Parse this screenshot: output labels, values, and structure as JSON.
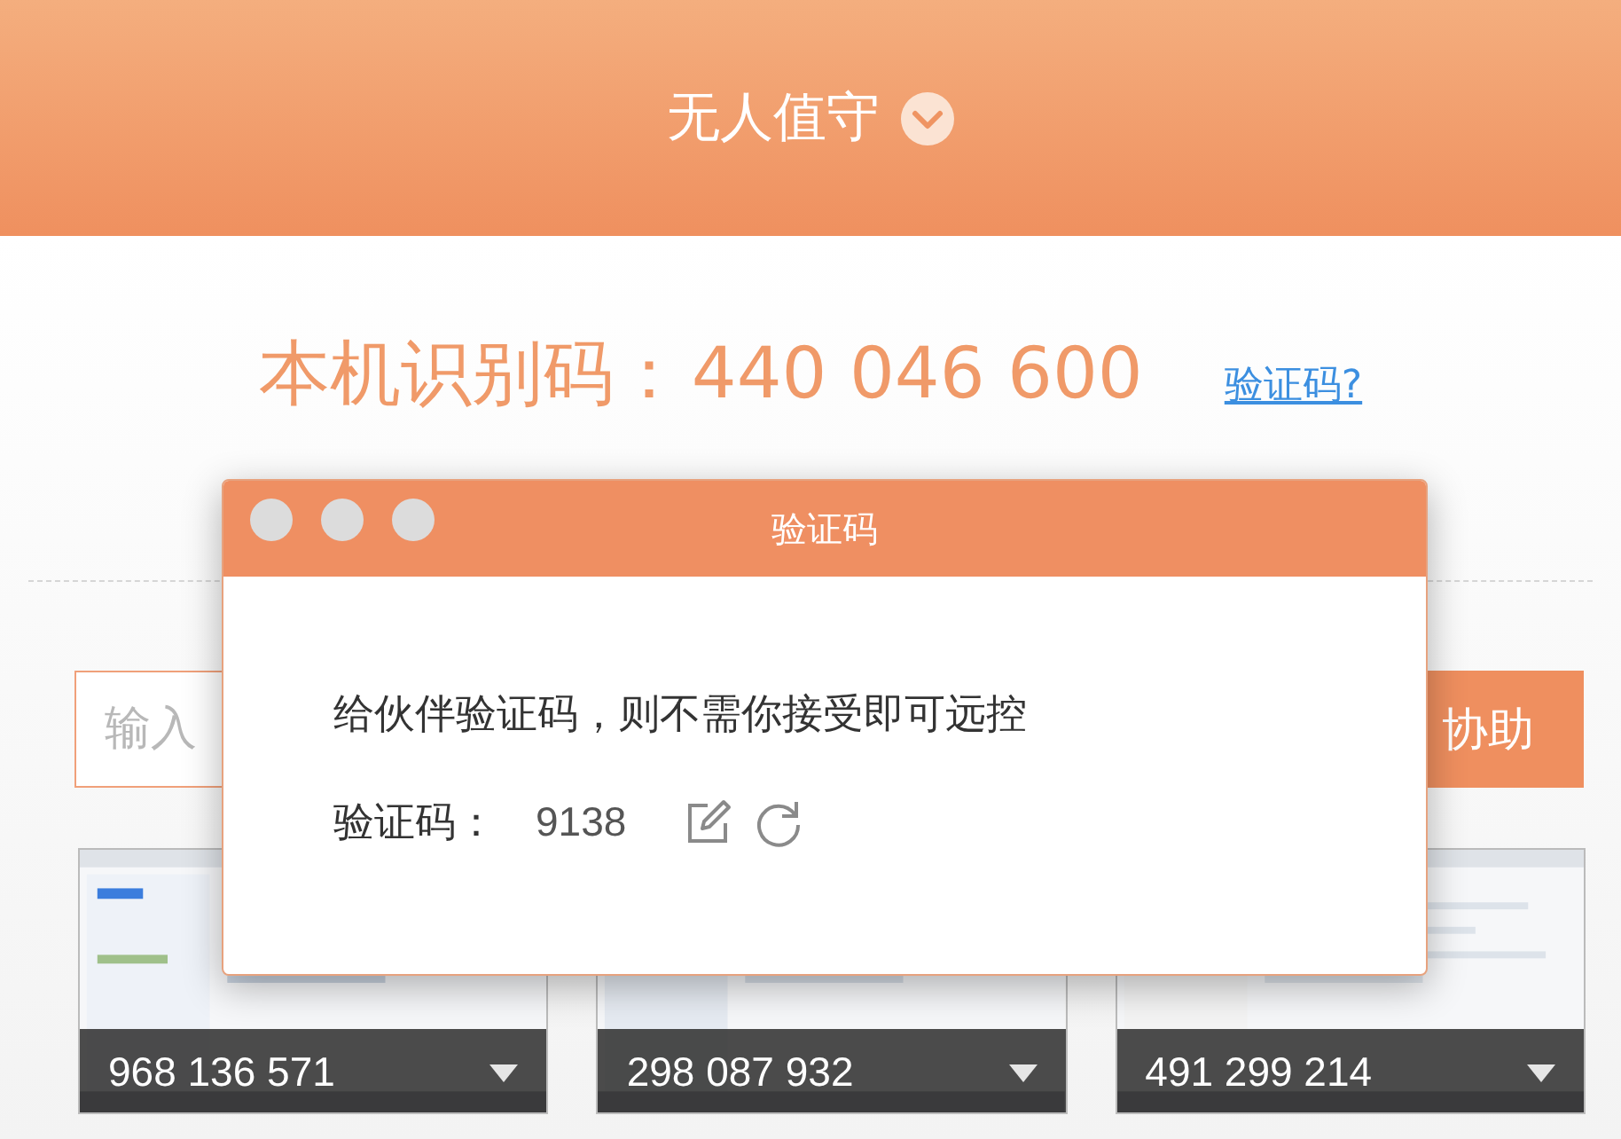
{
  "header": {
    "title": "无人值守"
  },
  "device": {
    "label": "本机识别码：",
    "id": "440 046 600",
    "link": "验证码?"
  },
  "connect": {
    "placeholder": "输入",
    "button": "协助"
  },
  "recent": [
    {
      "id": "968 136 571"
    },
    {
      "id": "298 087 932"
    },
    {
      "id": "491 299 214"
    }
  ],
  "dialog": {
    "title": "验证码",
    "message": "给伙伴验证码，则不需你接受即可远控",
    "code_label": "验证码：",
    "code": "9138"
  }
}
